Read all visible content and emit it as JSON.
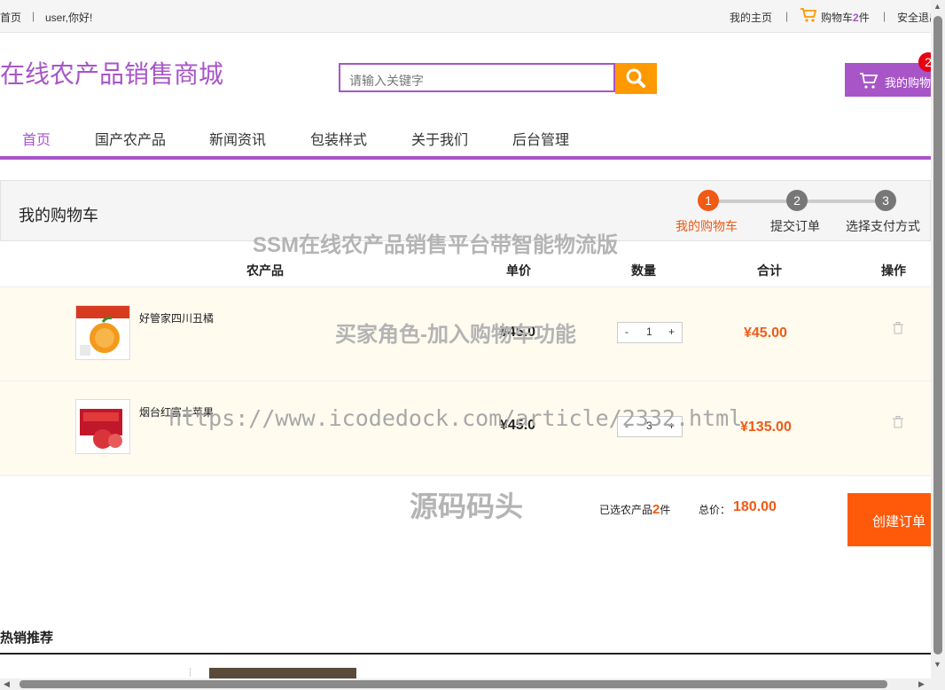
{
  "topbar": {
    "home": "首页",
    "sep": "|",
    "greeting": "user,你好!",
    "my_home": "我的主页",
    "cart_label": "购物车",
    "cart_count": "2",
    "cart_unit": "件",
    "logout": "安全退出"
  },
  "header": {
    "logo": "在线农产品销售商城",
    "search_placeholder": "请输入关键字",
    "my_cart": "我的购物车",
    "cart_badge": "2"
  },
  "nav": {
    "items": [
      "首页",
      "国产农产品",
      "新闻资讯",
      "包装样式",
      "关于我们",
      "后台管理"
    ],
    "active_color": "#a855c8"
  },
  "cart": {
    "title": "我的购物车",
    "steps": [
      {
        "num": "1",
        "label": "我的购物车",
        "active": true
      },
      {
        "num": "2",
        "label": "提交订单",
        "active": false
      },
      {
        "num": "3",
        "label": "选择支付方式",
        "active": false
      }
    ],
    "columns": {
      "product": "农产品",
      "price": "单价",
      "qty": "数量",
      "subtotal": "合计",
      "action": "操作"
    },
    "items": [
      {
        "name": "好管家四川丑橘",
        "price": "¥45.0",
        "qty": "1",
        "subtotal": "¥45.00",
        "image_icon": "orange-fruit-icon"
      },
      {
        "name": "烟台红富士苹果",
        "price": "¥45.0",
        "qty": "3",
        "subtotal": "¥135.00",
        "image_icon": "apple-box-icon"
      }
    ],
    "qty_minus": "-",
    "qty_plus": "+",
    "summary": {
      "selected_prefix": "已选农产品",
      "selected_count": "2",
      "selected_suffix": "件",
      "total_label": "总价：",
      "total_value": "180.00"
    },
    "create_order": "创建订单"
  },
  "hot": {
    "title": "热销推荐"
  },
  "watermarks": [
    "SSM在线农产品销售平台带智能物流版",
    "买家角色-加入购物车功能",
    "https://www.icodedock.com/article/2332.html",
    "源码码头"
  ],
  "colors": {
    "brand": "#a855c8",
    "accent": "#ff9900",
    "price_orange": "#f05a14",
    "create_button": "#ff5a0a",
    "badge": "#e60012",
    "row_bg": "#fffbef"
  }
}
